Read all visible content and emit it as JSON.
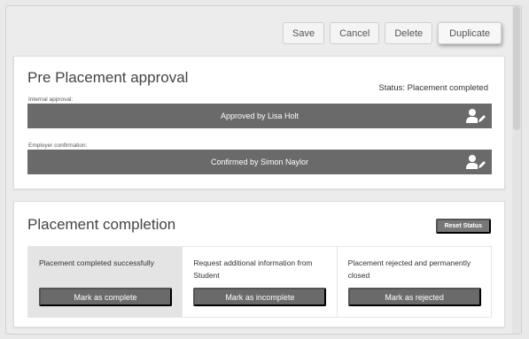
{
  "toolbar": {
    "save_label": "Save",
    "cancel_label": "Cancel",
    "delete_label": "Delete",
    "duplicate_label": "Duplicate"
  },
  "pre_placement": {
    "title": "Pre Placement approval",
    "status": "Status: Placement completed",
    "internal_label": "Internal approval:",
    "internal_value": "Approved by Lisa Holt",
    "employer_label": "Employer confirmation:",
    "employer_value": "Confirmed by Simon Naylor",
    "icon": "user-edit-icon"
  },
  "completion": {
    "title": "Placement completion",
    "reset_label": "Reset Status",
    "options": [
      {
        "text": "Placement completed successfully",
        "button": "Mark as complete",
        "selected": true
      },
      {
        "text": "Request additional information from Student",
        "button": "Mark as incomplete",
        "selected": false
      },
      {
        "text": "Placement rejected and permanently closed",
        "button": "Mark as rejected",
        "selected": false
      }
    ]
  },
  "colors": {
    "bar": "#6a6a6a",
    "selected_bg": "#e4e4e4",
    "background": "#ececec"
  }
}
